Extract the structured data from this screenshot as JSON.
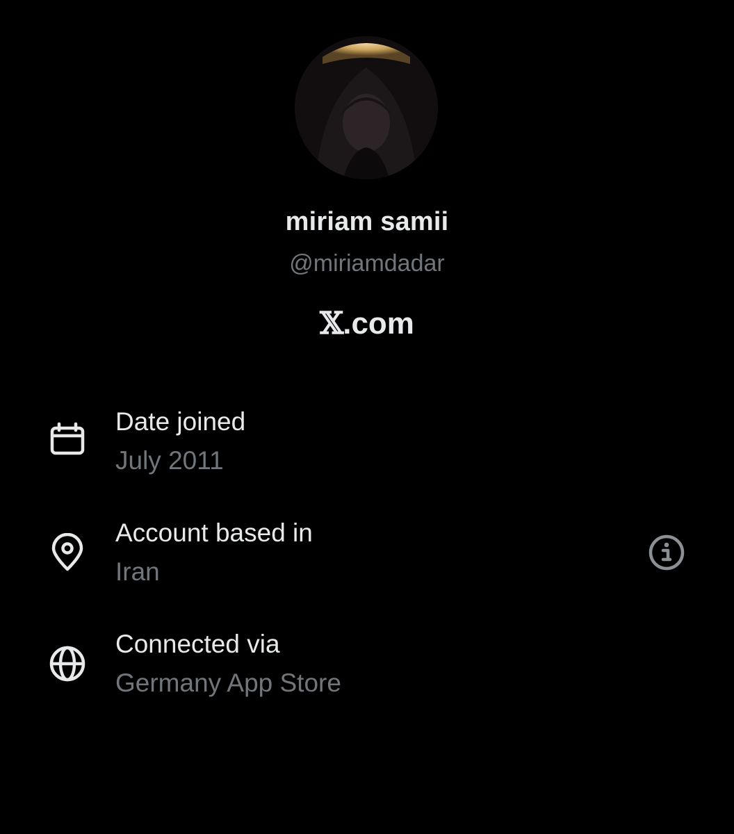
{
  "profile": {
    "display_name": "miriam samii",
    "handle": "@miriamdadar",
    "site_x": "𝕏",
    "site_rest": ".com",
    "avatar_icon": "avatar-photo"
  },
  "details": [
    {
      "icon": "calendar-icon",
      "label": "Date joined",
      "value": "July 2011"
    },
    {
      "icon": "location-pin-icon",
      "label": "Account based in",
      "value": "Iran"
    },
    {
      "icon": "globe-icon",
      "label": "Connected via",
      "value": "Germany App Store"
    }
  ],
  "colors": {
    "background": "#000000",
    "primary_text": "#e7e9ea",
    "secondary_text": "#71767b"
  }
}
